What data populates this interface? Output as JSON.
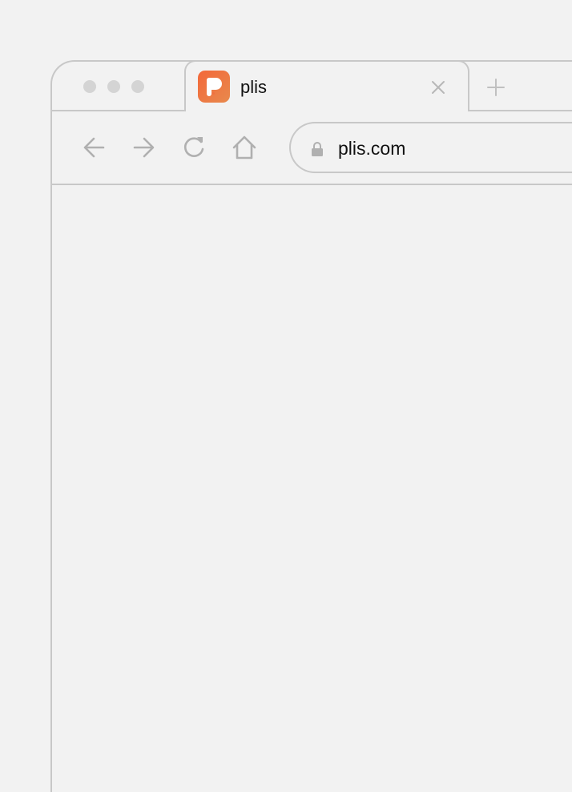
{
  "tab": {
    "title": "plis",
    "favicon": "plis-logo-icon",
    "favicon_colors": [
      "#f3683a",
      "#e8894d"
    ]
  },
  "toolbar": {
    "back_icon": "arrow-left-icon",
    "forward_icon": "arrow-right-icon",
    "reload_icon": "reload-icon",
    "home_icon": "home-icon"
  },
  "address_bar": {
    "url": "plis.com",
    "security_icon": "lock-icon"
  },
  "colors": {
    "background": "#f2f2f2",
    "border": "#c8c8c8",
    "icon_gray": "#b0b0b0",
    "text": "#111111"
  }
}
